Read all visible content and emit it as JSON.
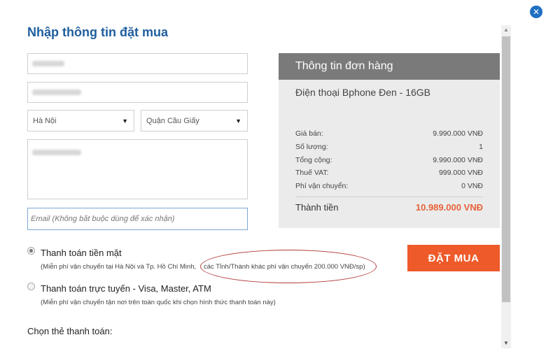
{
  "form": {
    "title": "Nhập thông tin đặt mua",
    "city_select": "Hà Nội",
    "district_select": "Quận Cầu Giấy",
    "email_placeholder": "Email (Không bắt buộc dùng để xác nhận)"
  },
  "payment": {
    "cash_label": "Thanh toán tiền mặt",
    "cash_note_part1": "(Miễn phí vận chuyển tại Hà Nội và Tp. Hồ Chí Minh,",
    "cash_note_part2": "các Tỉnh/Thành khác phí vận chuyển 200.000 VNĐ/sp)",
    "online_label": "Thanh toán trực tuyến - Visa, Master, ATM",
    "online_note": "(Miễn phí vận chuyển tận nơi trên toàn quốc khi chọn hình thức thanh toán này)",
    "card_section_label": "Chọn thẻ thanh toán:"
  },
  "order": {
    "header": "Thông tin đơn hàng",
    "product": "Điện thoại Bphone Đen - 16GB",
    "rows": [
      {
        "label": "Giá bán:",
        "value": "9.990.000 VNĐ"
      },
      {
        "label": "Số lượng:",
        "value": "1"
      },
      {
        "label": "Tổng cộng:",
        "value": "9.990.000 VNĐ"
      },
      {
        "label": "Thuế VAT:",
        "value": "999.000 VNĐ"
      },
      {
        "label": "Phí vận chuyển:",
        "value": "0 VNĐ"
      }
    ],
    "total_label": "Thành tiền",
    "total_value": "10.989.000 VNĐ"
  },
  "buy_button": "ĐẶT MUA",
  "icons": {
    "close": "close-icon",
    "dropdown": "chevron-down-icon"
  },
  "colors": {
    "title": "#1f5e9e",
    "order_header": "#7a7a7a",
    "accent": "#ee5a2a",
    "close": "#1f6fc2"
  }
}
